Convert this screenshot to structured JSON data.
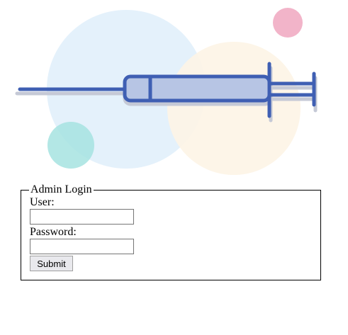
{
  "illustration": {
    "icon": "syringe-icon",
    "colors": {
      "bubble_blue": "#e4f1fb",
      "bubble_peach": "#fdf4e6",
      "bubble_teal": "#a6e3e0",
      "bubble_pink": "#f2b4c9",
      "syringe_stroke": "#3f5fb3",
      "syringe_fill": "#b4c4e6",
      "syringe_shadow": "#c5c9d6"
    }
  },
  "login_form": {
    "legend": "Admin Login",
    "user_label": "User:",
    "user_value": "",
    "password_label": "Password:",
    "password_value": "",
    "submit_label": "Submit"
  }
}
